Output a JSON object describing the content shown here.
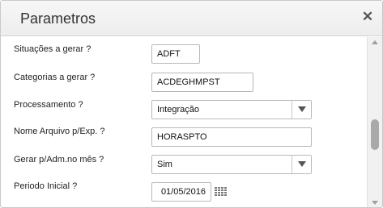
{
  "dialog": {
    "title": "Parametros",
    "close_glyph": "✕"
  },
  "fields": {
    "situacoes": {
      "label": "Situações a gerar ?",
      "value": "ADFT"
    },
    "categorias": {
      "label": "Categorias a gerar ?",
      "value": "ACDEGHMPST"
    },
    "processamento": {
      "label": "Processamento ?",
      "value": "Integração"
    },
    "nome_arquivo": {
      "label": "Nome Arquivo p/Exp. ?",
      "value": "HORASPTO"
    },
    "gerar_adm": {
      "label": "Gerar p/Adm.no mês ?",
      "value": "Sim"
    },
    "periodo_inicial": {
      "label": "Periodo Inicial ?",
      "value": "01/05/2016"
    }
  },
  "icons": {
    "close": "close-icon",
    "dropdown": "chevron-down-icon",
    "calendar": "calendar-icon"
  }
}
